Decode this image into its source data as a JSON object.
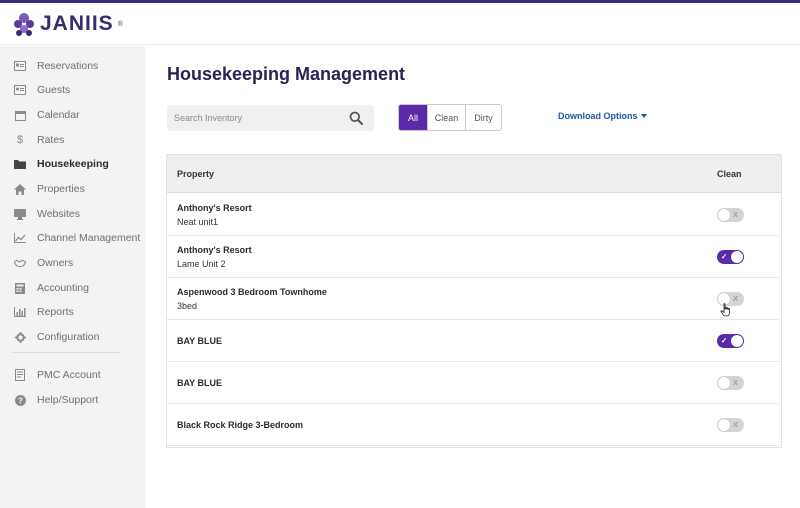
{
  "brand": {
    "name": "JANIIS",
    "reg": "®"
  },
  "sidebar": {
    "items": [
      {
        "label": "Reservations",
        "icon": "reservations-icon"
      },
      {
        "label": "Guests",
        "icon": "guests-icon"
      },
      {
        "label": "Calendar",
        "icon": "calendar-icon"
      },
      {
        "label": "Rates",
        "icon": "dollar-icon"
      },
      {
        "label": "Housekeeping",
        "icon": "folder-icon",
        "active": true
      },
      {
        "label": "Properties",
        "icon": "home-icon"
      },
      {
        "label": "Websites",
        "icon": "monitor-icon"
      },
      {
        "label": "Channel Management",
        "icon": "chart-line-icon"
      },
      {
        "label": "Owners",
        "icon": "handshake-icon"
      },
      {
        "label": "Accounting",
        "icon": "calculator-icon"
      },
      {
        "label": "Reports",
        "icon": "bar-chart-icon"
      },
      {
        "label": "Configuration",
        "icon": "gear-icon"
      }
    ],
    "secondary": [
      {
        "label": "PMC Account",
        "icon": "account-icon"
      },
      {
        "label": "Help/Support",
        "icon": "help-icon"
      }
    ]
  },
  "page": {
    "title": "Housekeeping Management"
  },
  "search": {
    "placeholder": "Search Inventory"
  },
  "filters": {
    "all": "All",
    "clean": "Clean",
    "dirty": "Dirty",
    "selected": "All"
  },
  "download": {
    "label": "Download Options"
  },
  "table": {
    "headers": {
      "property": "Property",
      "clean": "Clean"
    },
    "rows": [
      {
        "name": "Anthony's Resort",
        "unit": "Neat unit1",
        "clean": false
      },
      {
        "name": "Anthony's Resort",
        "unit": "Lame Unit 2",
        "clean": true
      },
      {
        "name": "Aspenwood 3 Bedroom Townhome",
        "unit": "3bed",
        "clean": false
      },
      {
        "name": "BAY BLUE",
        "unit": "",
        "clean": true
      },
      {
        "name": "BAY BLUE",
        "unit": "",
        "clean": false
      },
      {
        "name": "Black Rock Ridge 3-Bedroom",
        "unit": "",
        "clean": false
      }
    ],
    "toggle_on_mark": "✓",
    "toggle_off_mark": "X"
  },
  "colors": {
    "accent": "#5b2aa8",
    "brand": "#3a2a6e",
    "link": "#1e5aa0",
    "title": "#2e2152"
  }
}
